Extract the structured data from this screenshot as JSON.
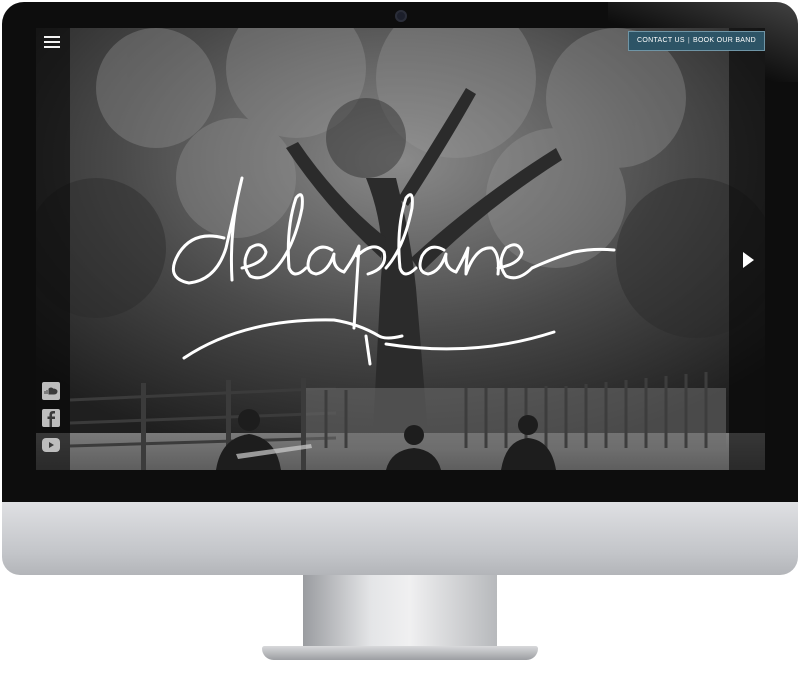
{
  "header": {
    "contact_label": "CONTACT US",
    "book_label": "BOOK OUR BAND",
    "separator": "|"
  },
  "hero": {
    "logo_text": "delaplane"
  },
  "social": {
    "icons": [
      "soundcloud-icon",
      "facebook-icon",
      "youtube-icon"
    ]
  },
  "colors": {
    "contact_button_bg": "#2d5466",
    "screen_overlay": "#000000",
    "logo": "#ffffff"
  }
}
